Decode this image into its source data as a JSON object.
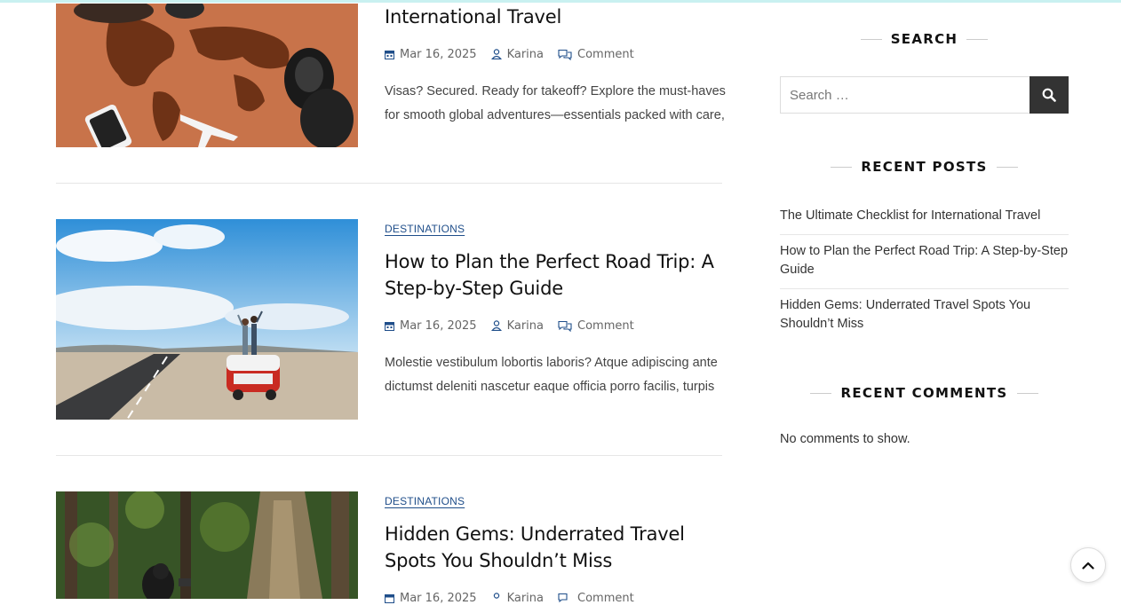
{
  "posts": [
    {
      "category": "",
      "title": "International Travel",
      "date": "Mar 16, 2025",
      "author": "Karina",
      "comment": "Comment",
      "excerpt": "Visas? Secured. Ready for takeoff? Explore the must-haves for smooth global adventures—essentials packed with care,"
    },
    {
      "category": "DESTINATIONS",
      "title": "How to Plan the Perfect Road Trip: A Step-by-Step Guide",
      "date": "Mar 16, 2025",
      "author": "Karina",
      "comment": "Comment",
      "excerpt": "Molestie vestibulum lobortis laboris? Atque adipiscing ante dictumst deleniti nascetur eaque officia porro facilis, turpis"
    },
    {
      "category": "DESTINATIONS",
      "title": "Hidden Gems: Underrated Travel Spots You Shouldn’t Miss",
      "date": "Mar 16, 2025",
      "author": "Karina",
      "comment": "Comment"
    }
  ],
  "sidebar": {
    "search": {
      "title": "SEARCH",
      "placeholder": "Search …"
    },
    "recent_posts": {
      "title": "RECENT POSTS",
      "items": [
        "The Ultimate Checklist for International Travel",
        "How to Plan the Perfect Road Trip: A Step-by-Step Guide",
        "Hidden Gems: Underrated Travel Spots You Shouldn’t Miss"
      ]
    },
    "recent_comments": {
      "title": "RECENT COMMENTS",
      "empty_text": "No comments to show."
    }
  },
  "colors": {
    "accent": "#1f4e8a",
    "search_button": "#333333"
  },
  "icons": {
    "calendar": "calendar-icon",
    "author": "user-icon",
    "comment": "comment-icon",
    "search": "search-icon",
    "scroll_top": "chevron-up-icon"
  }
}
